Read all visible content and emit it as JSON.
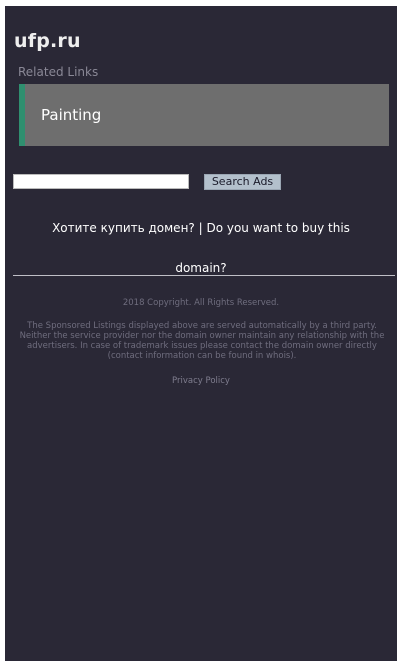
{
  "header": {
    "site_title": "ufp.ru"
  },
  "related": {
    "label": "Related Links",
    "links": [
      {
        "label": "Painting"
      }
    ],
    "accent_color": "#2f8f6f"
  },
  "search": {
    "value": "",
    "placeholder": "",
    "button_label": "Search Ads"
  },
  "buy": {
    "line1": "Хотите купить домен? | Do you want to buy this",
    "line2": "domain?"
  },
  "footer": {
    "copyright": "2018 Copyright. All Rights Reserved.",
    "disclaimer": "The Sponsored Listings displayed above are served automatically by a third party. Neither the service provider nor the domain owner maintain any relationship with the advertisers. In case of trademark issues please contact the domain owner directly (contact information can be found in whois).",
    "privacy_label": "Privacy Policy"
  }
}
